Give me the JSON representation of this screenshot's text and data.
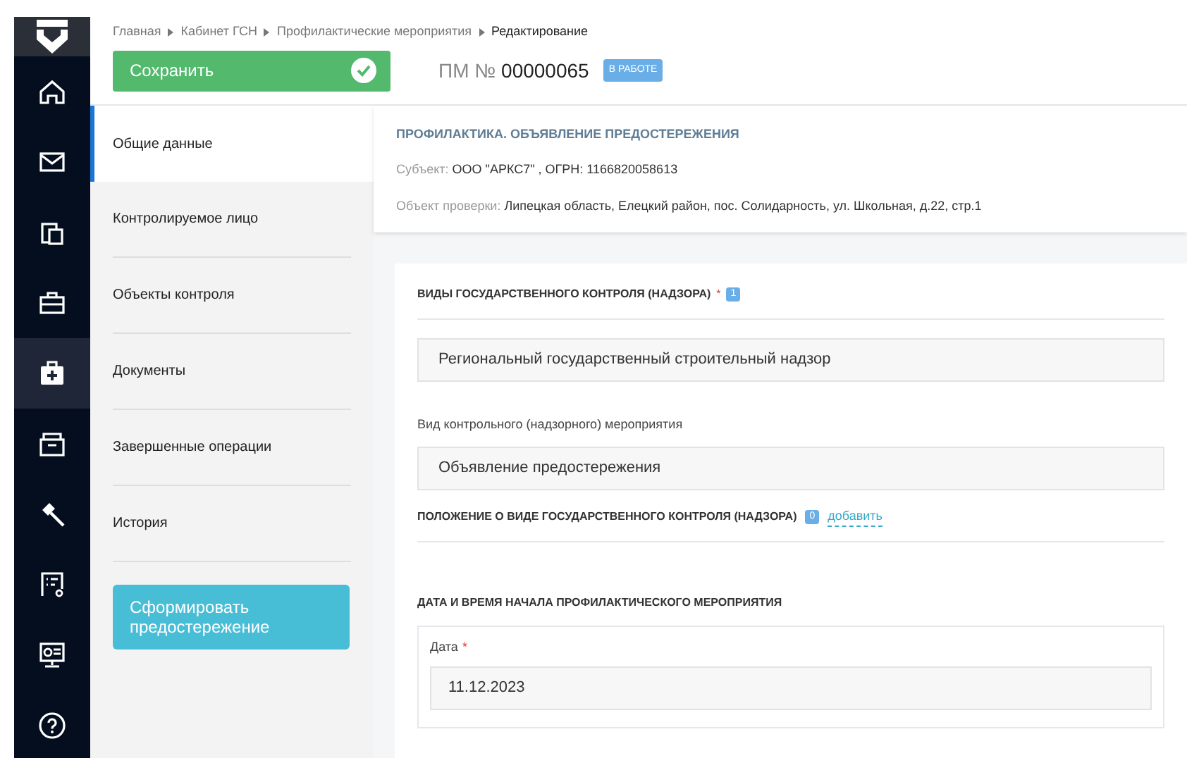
{
  "rail": [
    {
      "kind": "home",
      "selected": false
    },
    {
      "kind": "mail",
      "selected": false
    },
    {
      "kind": "clipboard",
      "selected": false
    },
    {
      "kind": "briefcase",
      "selected": false
    },
    {
      "kind": "medkit",
      "selected": true
    },
    {
      "kind": "folder",
      "selected": false
    },
    {
      "kind": "hammer",
      "selected": false
    },
    {
      "kind": "list",
      "selected": false
    },
    {
      "kind": "monitor",
      "selected": false
    },
    {
      "kind": "help",
      "selected": false
    }
  ],
  "breadcrumbs": [
    {
      "label": "Главная",
      "current": false
    },
    {
      "label": "Кабинет ГСН",
      "current": false
    },
    {
      "label": "Профилактические мероприятия",
      "current": false
    },
    {
      "label": "Редактирование",
      "current": true
    }
  ],
  "save_button": "Сохранить",
  "title": {
    "prefix": "ПМ №",
    "number": "00000065",
    "status": "В РАБОТЕ"
  },
  "nav": [
    {
      "label": "Общие данные",
      "selected": true
    },
    {
      "label": "Контролируемое лицо",
      "selected": false
    },
    {
      "label": "Объекты контроля",
      "selected": false
    },
    {
      "label": "Документы",
      "selected": false
    },
    {
      "label": "Завершенные операции",
      "selected": false
    },
    {
      "label": "История",
      "selected": false
    }
  ],
  "action_button": "Сформировать предостережение",
  "info": {
    "heading": "ПРОФИЛАКТИКА. ОБЪЯВЛЕНИЕ ПРЕДОСТЕРЕЖЕНИЯ",
    "lines": [
      {
        "label": "Субъект:",
        "value": "ООО \"АРКС7\" , ОГРН: 1166820058613"
      },
      {
        "label": "Объект проверки:",
        "value": "Липецкая область, Елецкий район, пос. Солидарность, ул. Школьная, д.22, стр.1"
      }
    ]
  },
  "control_types": {
    "heading": "ВИДЫ ГОСУДАРСТВЕННОГО КОНТРОЛЯ (НАДЗОРА)",
    "required_mark": "*",
    "count": "1",
    "value": "Региональный государственный строительный надзор"
  },
  "event_type": {
    "label": "Вид контрольного (надзорного) мероприятия",
    "value": "Объявление предостережения"
  },
  "regulation": {
    "heading": "ПОЛОЖЕНИЕ О ВИДЕ ГОСУДАРСТВЕННОГО КОНТРОЛЯ (НАДЗОРА)",
    "count": "0",
    "link": "добавить"
  },
  "start": {
    "heading": "ДАТА И ВРЕМЯ НАЧАЛА ПРОФИЛАКТИЧЕСКОГО МЕРОПРИЯТИЯ",
    "date_label": "Дата",
    "required_mark": "*",
    "date": "11.12.2023"
  }
}
